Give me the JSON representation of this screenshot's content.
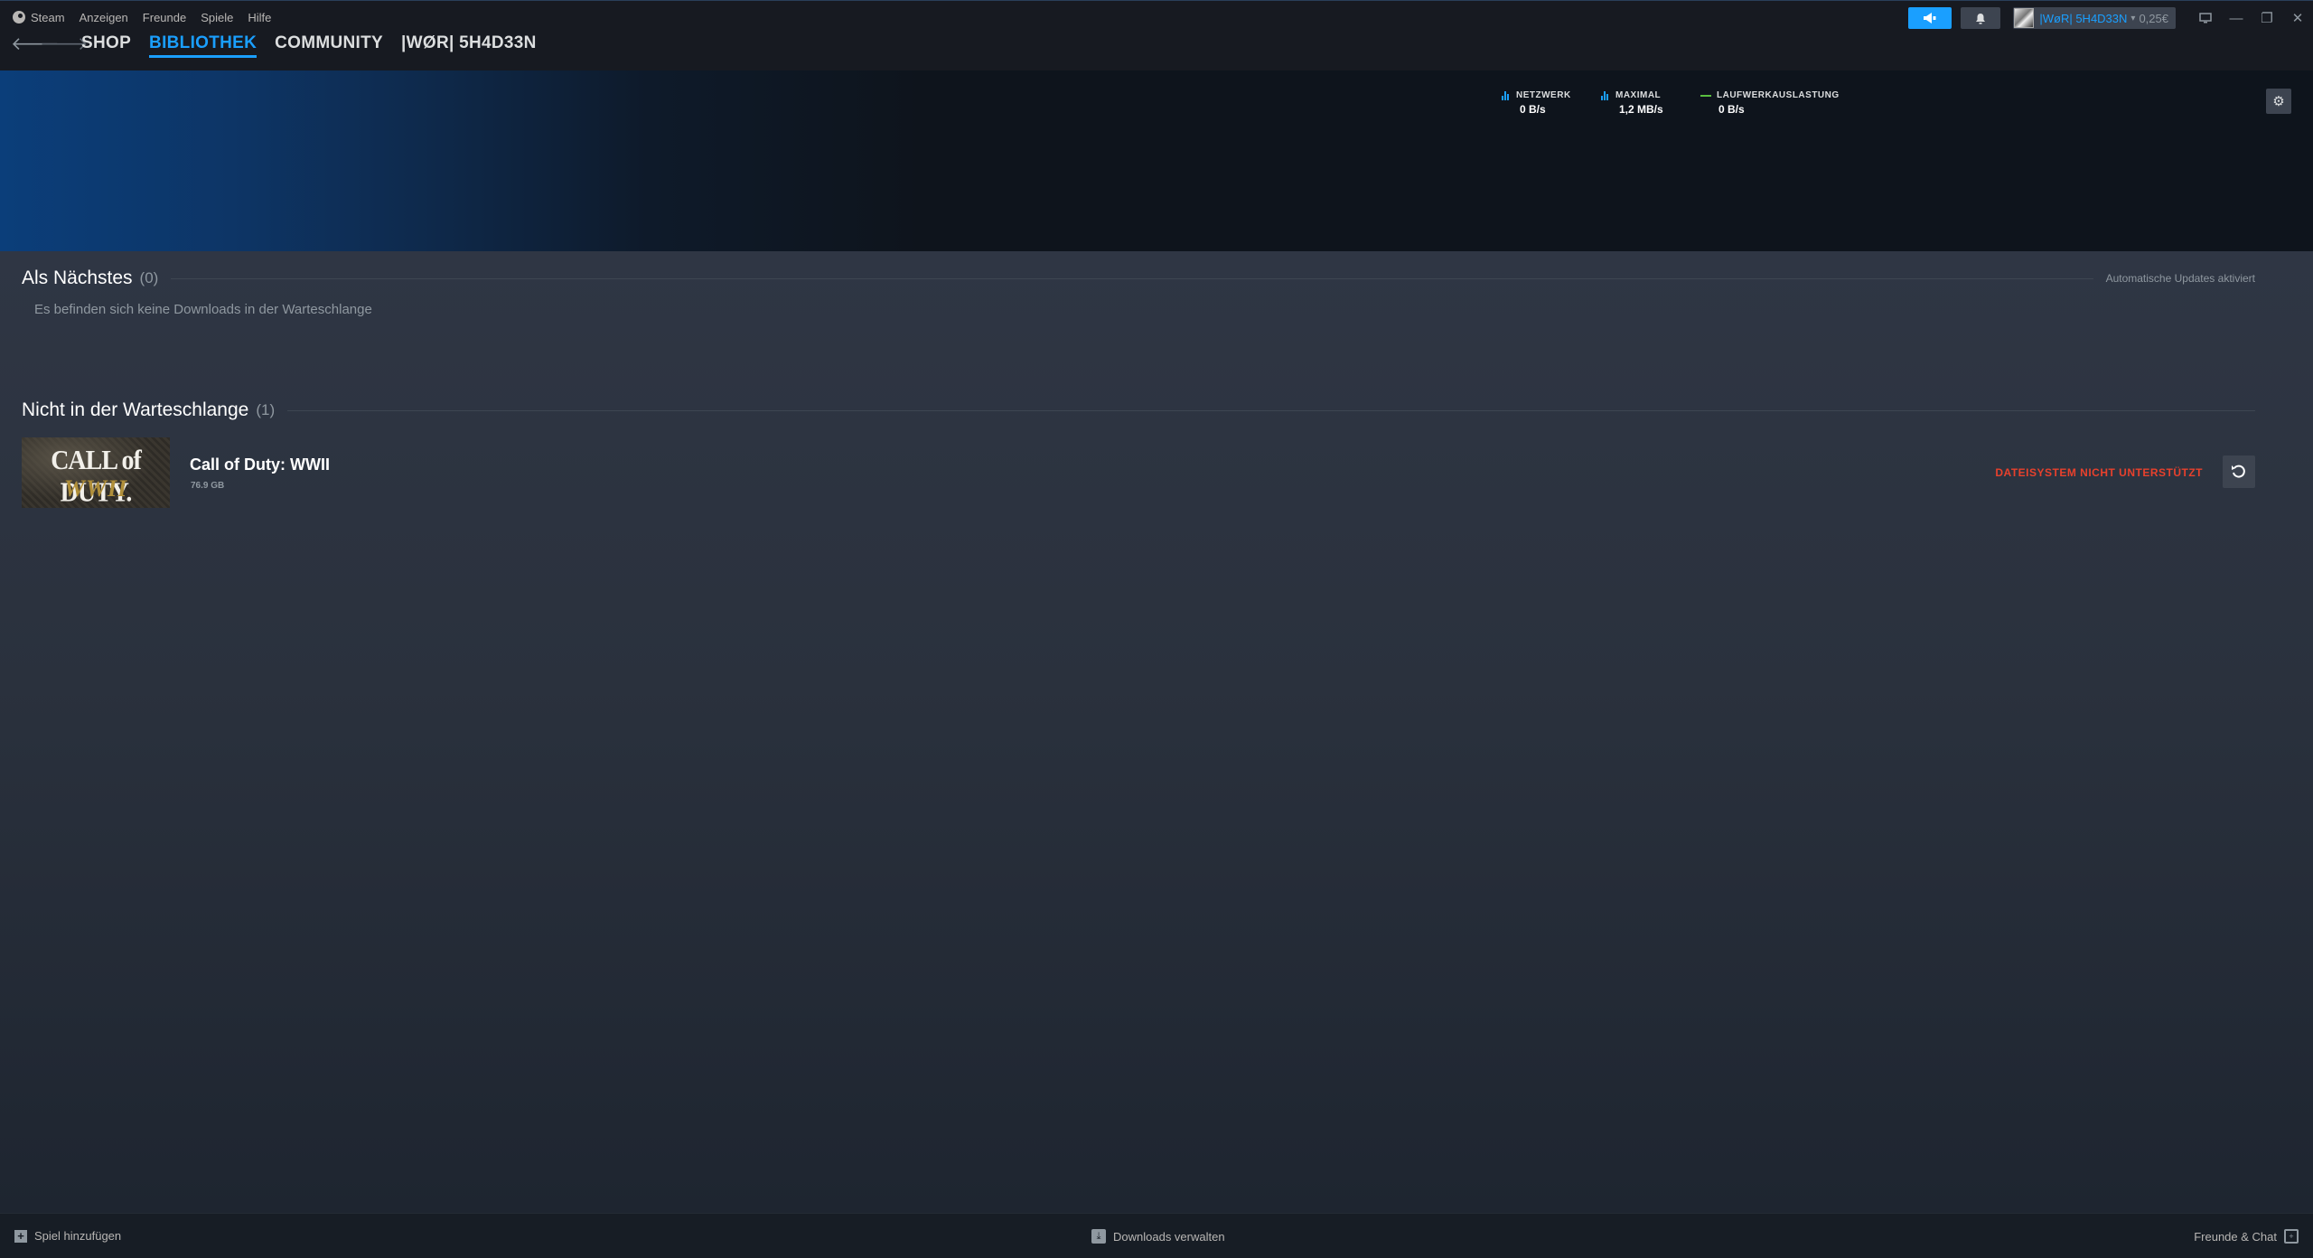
{
  "menu": {
    "items": [
      "Steam",
      "Anzeigen",
      "Freunde",
      "Spiele",
      "Hilfe"
    ]
  },
  "account": {
    "name": "|WøR| 5H4D33N",
    "balance": "0,25€"
  },
  "nav": {
    "back_icon": "arrow-left-icon",
    "forward_icon": "arrow-right-icon",
    "tabs": [
      {
        "label": "SHOP",
        "active": false
      },
      {
        "label": "BIBLIOTHEK",
        "active": true
      },
      {
        "label": "COMMUNITY",
        "active": false
      },
      {
        "label": "|WØR| 5H4D33N",
        "active": false
      }
    ]
  },
  "stats": {
    "network": {
      "label": "NETZWERK",
      "value": "0 B/s"
    },
    "peak": {
      "label": "MAXIMAL",
      "value": "1,2 MB/s"
    },
    "disk": {
      "label": "LAUFWERKAUSLASTUNG",
      "value": "0 B/s"
    }
  },
  "queue": {
    "title": "Als Nächstes",
    "count": "(0)",
    "note": "Automatische Updates aktiviert",
    "empty_text": "Es befinden sich keine Downloads in der Warteschlange"
  },
  "not_queued": {
    "title": "Nicht in der Warteschlange",
    "count": "(1)",
    "game": {
      "thumb_line1": "CALL of DUTY.",
      "thumb_line2": "WWII",
      "title": "Call of Duty: WWII",
      "size": "76.9 GB",
      "status": "DATEISYSTEM NICHT UNTERSTÜTZT"
    }
  },
  "footer": {
    "add_game": "Spiel hinzufügen",
    "manage_downloads": "Downloads verwalten",
    "friends_chat": "Freunde & Chat"
  },
  "colors": {
    "accent": "#1a9fff",
    "error": "#e8412c",
    "disk_line": "#59bf40"
  }
}
